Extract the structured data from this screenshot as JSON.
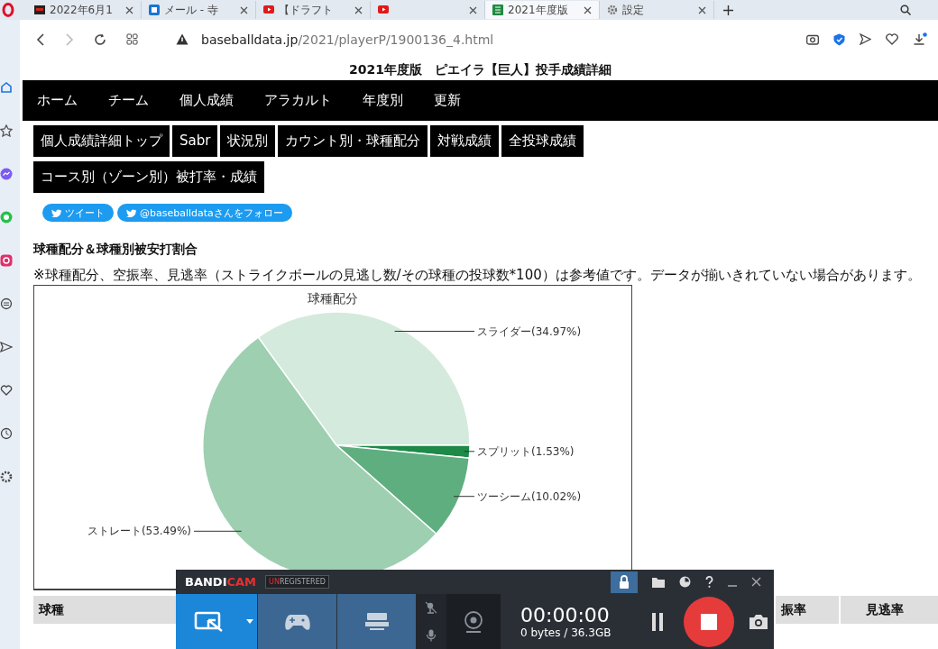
{
  "browser": {
    "tabs": [
      {
        "title": "2022年6月1",
        "selected": false
      },
      {
        "title": "メール - 寺",
        "selected": false
      },
      {
        "title": "【ドラフト",
        "selected": false
      },
      {
        "selected": false
      },
      {
        "title": "2021年度版",
        "selected": true
      },
      {
        "title": "設定",
        "selected": false
      }
    ],
    "address": {
      "host": "baseballdata.jp",
      "path": "/2021/playerP/1900136_4.html"
    }
  },
  "page": {
    "title": "2021年度版　ピエイラ【巨人】投手成績詳細",
    "nav": [
      "ホーム",
      "チーム",
      "個人成績",
      "アラカルト",
      "年度別",
      "更新"
    ],
    "subnav": [
      [
        "個人成績詳細トップ",
        "Sabr",
        "状況別",
        "カウント別・球種配分",
        "対戦成績",
        "全投球成績"
      ],
      [
        "コース別（ゾーン別）被打率・成績"
      ]
    ],
    "share": [
      "ツイート",
      "@baseballdataさんをフォロー"
    ],
    "heading": "球種配分＆球種別被安打割合",
    "note": "※球種配分、空振率、見逃率（ストライクボールの見逃し数/その球種の投球数*100）は参考値です。データが揃いきれていない場合があります。",
    "chart_data": {
      "type": "pie",
      "title": "球種配分",
      "values": [
        34.97,
        1.53,
        10.02,
        53.49
      ],
      "colors": [
        "#d4eadc",
        "#1d8a48",
        "#5fae7f",
        "#9dcfb0"
      ],
      "value_labels": [
        "スライダー(34.97%)",
        "スプリット(1.53%)",
        "ツーシーム(10.02%)",
        "ストレート(53.49%)"
      ]
    },
    "table": {
      "columns": [
        "球種",
        "振率",
        "見逃率"
      ]
    }
  },
  "recorder": {
    "logo": [
      "BANDI",
      "CAM"
    ],
    "badge": [
      "UN",
      "REGISTERED"
    ],
    "timer": "00:00:00",
    "size": "0 bytes / 36.3GB"
  }
}
